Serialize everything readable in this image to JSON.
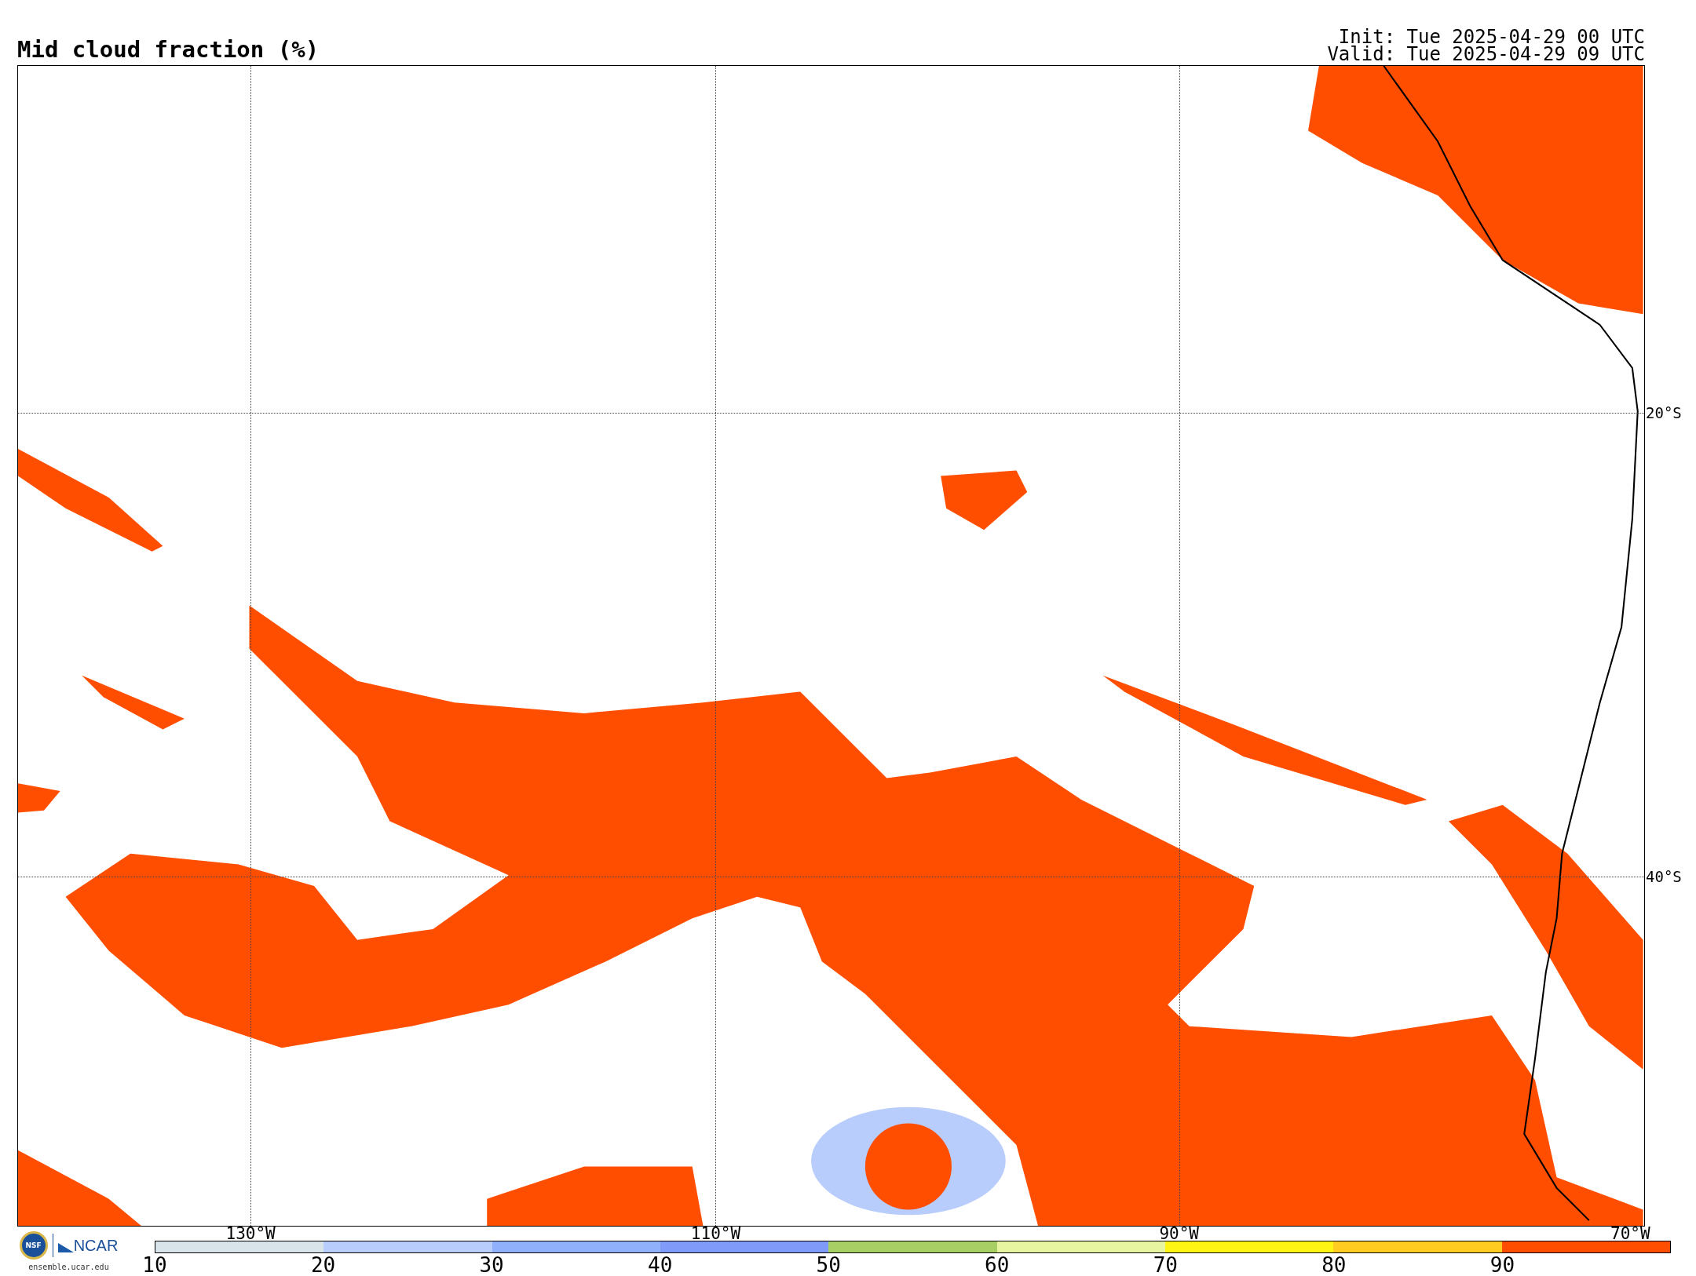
{
  "title": "Mid cloud fraction (%)",
  "run_info": [
    "Init: Tue 2025-04-29 00 UTC",
    "Valid: Tue 2025-04-29 09 UTC"
  ],
  "map": {
    "longitude_labels": [
      "130°W",
      "110°W",
      "90°W",
      "70°W"
    ],
    "latitude_labels": [
      "20°S",
      "40°S"
    ]
  },
  "logo": {
    "emblem": "NSF",
    "wordmark": "NCAR",
    "url": "ensemble.ucar.edu"
  },
  "colorbar": {
    "bins": [
      {
        "color": "#d8e3ea"
      },
      {
        "color": "#b8cdfb"
      },
      {
        "color": "#90b0fb"
      },
      {
        "color": "#7f9af8"
      },
      {
        "color": "#a8cf64"
      },
      {
        "color": "#e8f5a0"
      },
      {
        "color": "#fff514"
      },
      {
        "color": "#ffcc22"
      },
      {
        "color": "#ff4e00"
      }
    ],
    "tick_labels": [
      "10",
      "20",
      "30",
      "40",
      "50",
      "60",
      "70",
      "80",
      "90"
    ]
  }
}
